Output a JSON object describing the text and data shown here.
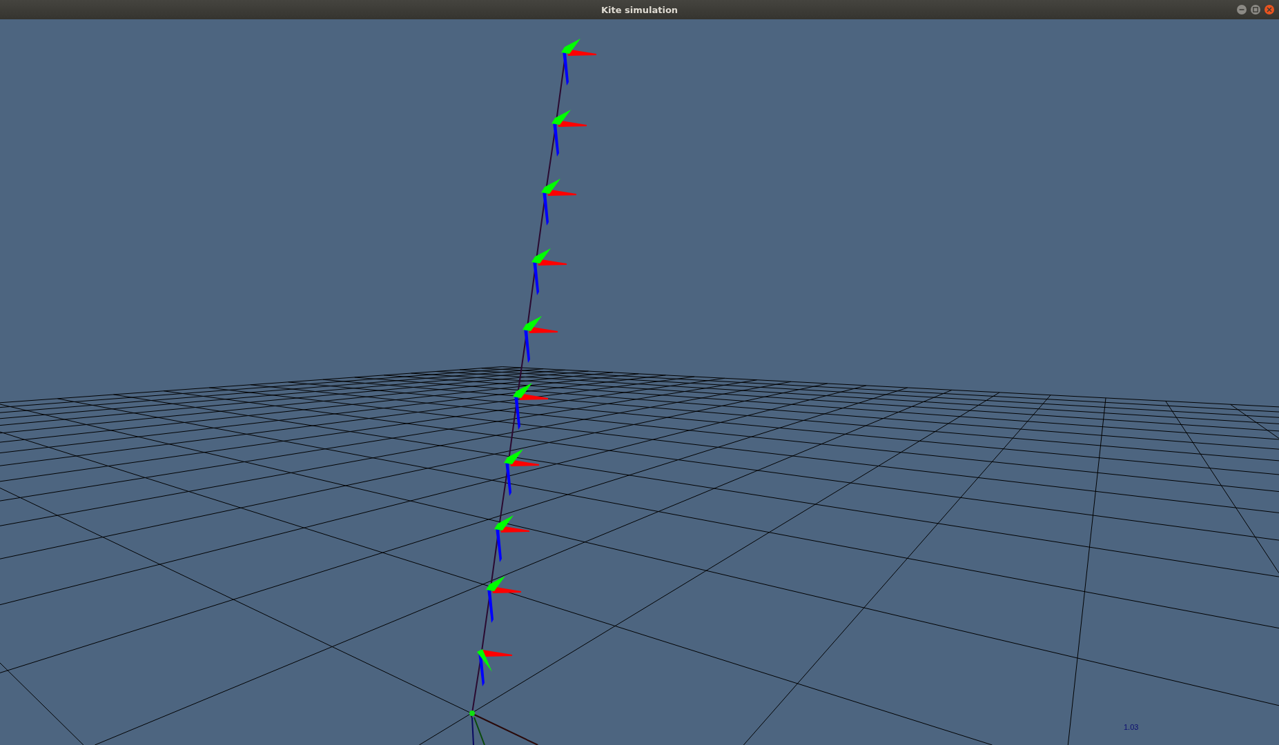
{
  "window": {
    "title": "Kite simulation"
  },
  "viewport": {
    "reading": "1.03"
  }
}
